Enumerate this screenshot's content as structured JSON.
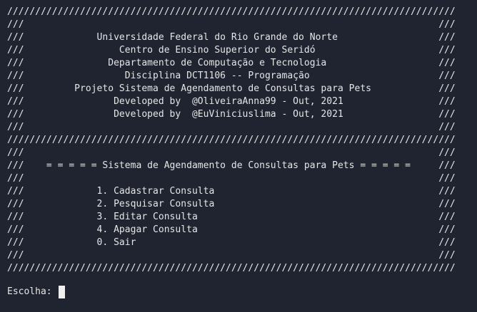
{
  "terminal": {
    "lines": [
      "////////////////////////////////////////////////////////////////////////////////",
      "///                                                                          ///",
      "///             Universidade Federal do Rio Grande do Norte                  ///",
      "///                 Centro de Ensino Superior do Seridó                      ///",
      "///               Departamento de Computação e Tecnologia                    ///",
      "///                  Disciplina DCT1106 -- Programação                       ///",
      "///         Projeto Sistema de Agendamento de Consultas para Pets            ///",
      "///                Developed by  @OliveiraAnna99 - Out, 2021                 ///",
      "///                Developed by  @EuViniciuslima - Out, 2021                 ///",
      "///                                                                          ///",
      "////////////////////////////////////////////////////////////////////////////////",
      "///                                                                          ///",
      "///    = = = = = Sistema de Agendamento de Consultas para Pets = = = = =     ///",
      "///                                                                          ///",
      "///             1. Cadastrar Consulta                                        ///",
      "///             2. Pesquisar Consulta                                        ///",
      "///             3. Editar Consulta                                           ///",
      "///             4. Apagar Consulta                                           ///",
      "///             0. Sair                                                      ///",
      "///                                                                          ///",
      "////////////////////////////////////////////////////////////////////////////////"
    ],
    "prompt": "Escolha: "
  }
}
